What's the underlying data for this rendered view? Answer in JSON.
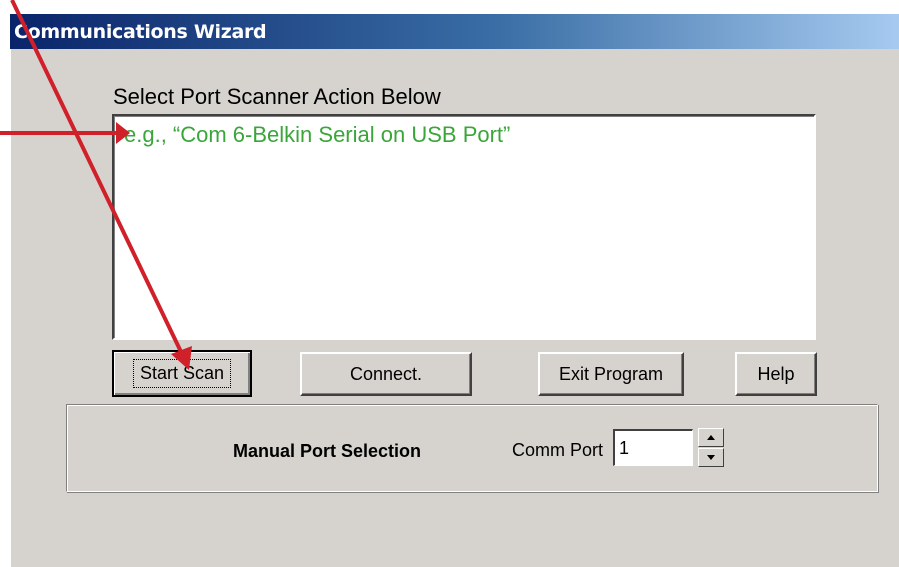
{
  "window": {
    "title": "Communications Wizard"
  },
  "scanner": {
    "section_label": "Select Port Scanner Action Below",
    "list_items": [
      "e.g., “Com 6-Belkin Serial on USB Port”"
    ]
  },
  "buttons": {
    "start_scan": "Start Scan",
    "connect": "Connect.",
    "exit_program": "Exit Program",
    "help": "Help"
  },
  "manual_port": {
    "group_label": "Manual Port Selection",
    "comm_port_label": "Comm Port",
    "comm_port_value": "1"
  },
  "icons": {
    "annotation_arrow": "red-arrow-icon",
    "list_marker": "red-triangle-icon",
    "spin_up": "spin-up-icon",
    "spin_down": "spin-down-icon"
  },
  "colors": {
    "annotation": "#d0202a",
    "example_text": "#3aa63a",
    "titlebar_start": "#0a246a",
    "titlebar_end": "#a6caf0",
    "dialog_bg": "#d6d3ce"
  }
}
